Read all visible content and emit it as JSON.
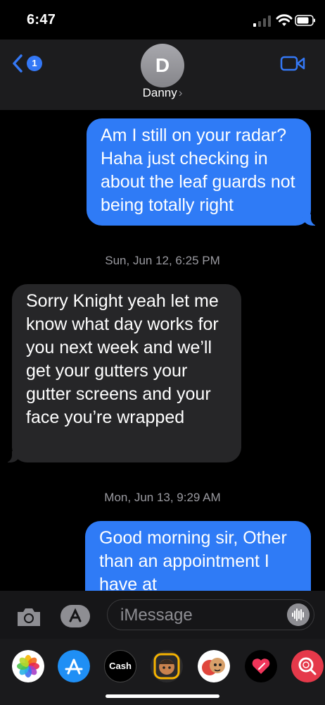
{
  "status_bar": {
    "time": "6:47"
  },
  "header": {
    "back_badge": "1",
    "avatar_initial": "D",
    "contact_name": "Danny",
    "chevron": "›"
  },
  "messages": [
    {
      "direction": "sent",
      "text": "Am I still on your radar? Haha just checking in about the leaf guards not being totally right"
    },
    {
      "type": "timestamp",
      "text": "Sun, Jun 12, 6:25 PM"
    },
    {
      "direction": "received",
      "text": "Sorry Knight yeah let me know what day works for you next week and we’ll get your gutters your gutter screens and your face you’re wrapped"
    },
    {
      "type": "timestamp",
      "text": "Mon, Jun 13, 9:29 AM"
    },
    {
      "direction": "sent",
      "text": "Good morning sir, Other than an appointment I have at"
    }
  ],
  "input": {
    "placeholder": "iMessage"
  },
  "app_drawer": {
    "apps": [
      {
        "name": "photos-app-icon"
      },
      {
        "name": "app-store-icon"
      },
      {
        "name": "apple-cash-icon",
        "label": "Cash"
      },
      {
        "name": "memoji-stickers-icon"
      },
      {
        "name": "animoji-icon"
      },
      {
        "name": "digital-touch-icon"
      },
      {
        "name": "image-search-icon"
      }
    ]
  },
  "colors": {
    "sent_bubble": "#2f7bf6",
    "received_bubble": "#262628",
    "accent": "#3478f6",
    "background": "#000000"
  }
}
